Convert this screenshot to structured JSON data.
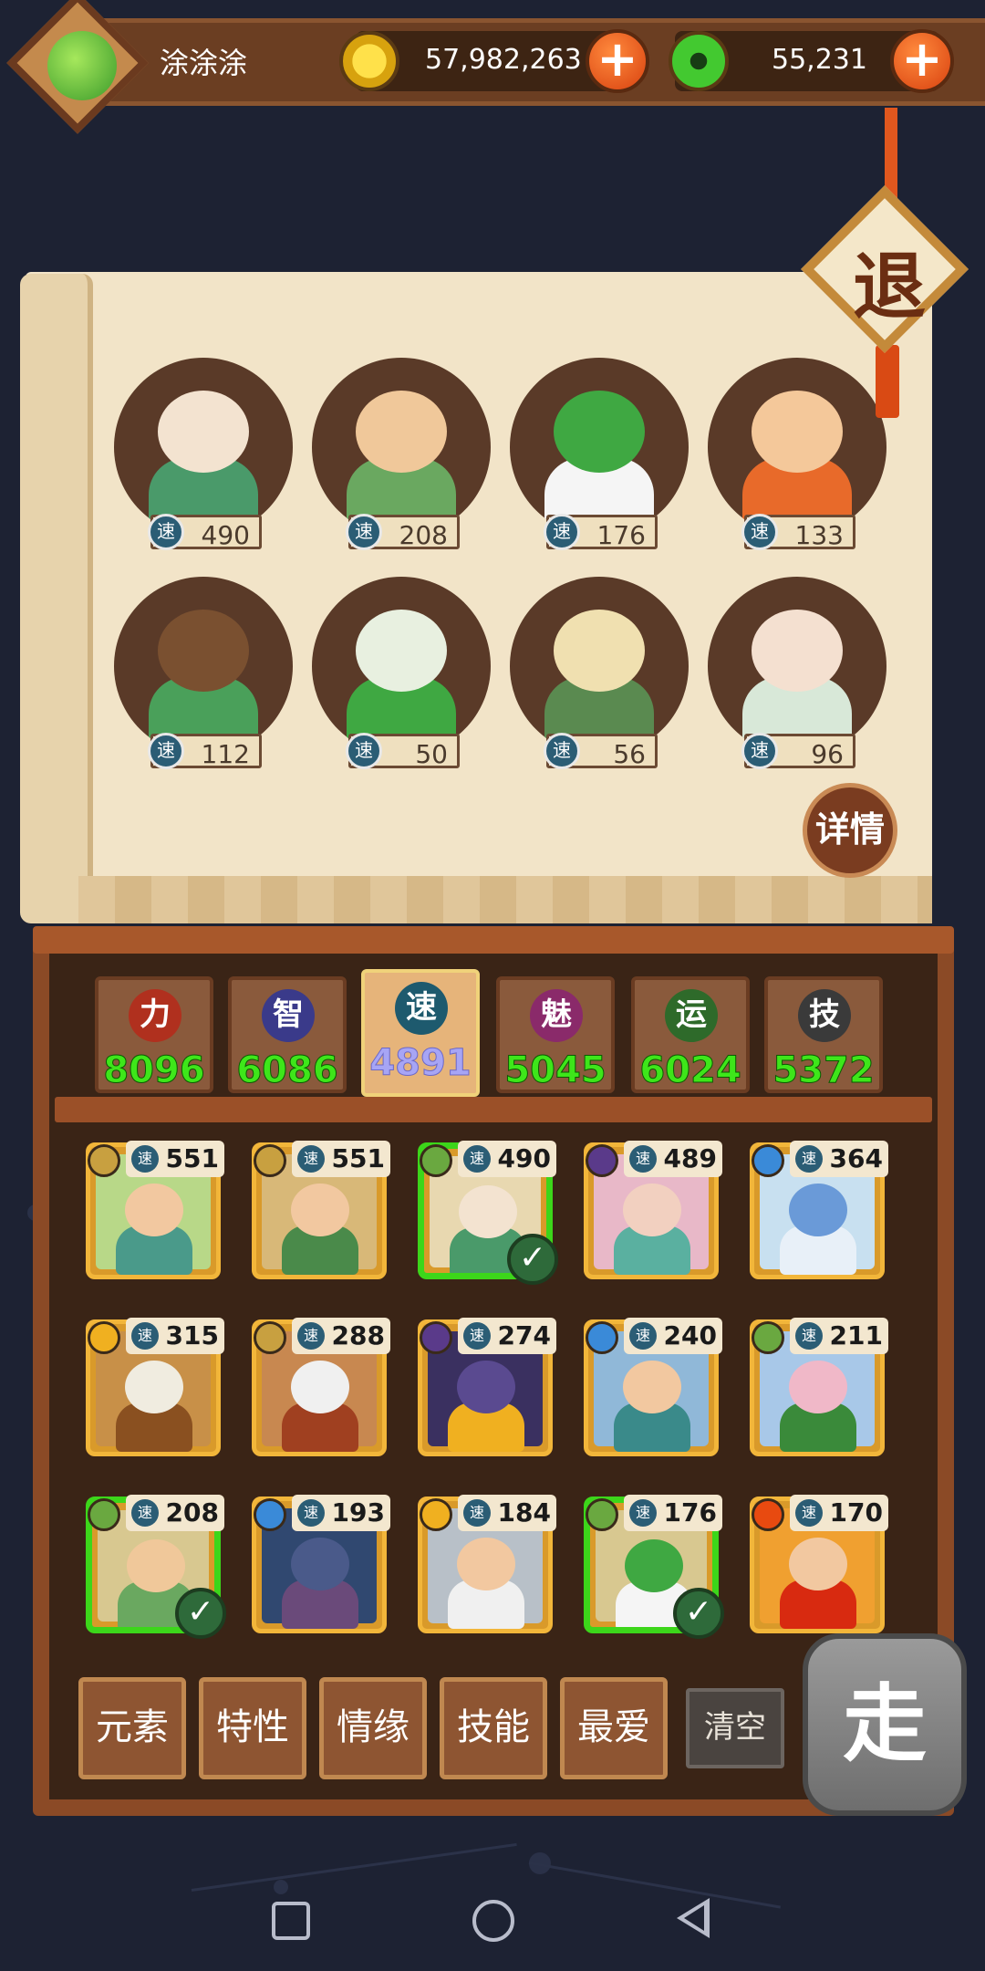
{
  "player": {
    "name": "涂涂涂",
    "gold": "57,982,263",
    "jade": "55,231",
    "plus_symbol": "+"
  },
  "exit_label": "退",
  "detail_label": "详情",
  "speed_char": "速",
  "team": [
    {
      "speed": "490",
      "color": "#f3e3d0",
      "body": "#4a9a6a"
    },
    {
      "speed": "208",
      "color": "#f0c89a",
      "body": "#6aa860"
    },
    {
      "speed": "176",
      "color": "#3fa842",
      "body": "#f5f5f5"
    },
    {
      "speed": "133",
      "color": "#f4c89a",
      "body": "#e86a2a"
    },
    {
      "speed": "112",
      "color": "#7a5030",
      "body": "#4aa05a"
    },
    {
      "speed": "50",
      "color": "#e8f0e0",
      "body": "#3fa842"
    },
    {
      "speed": "56",
      "color": "#f0e0b0",
      "body": "#5a8a50"
    },
    {
      "speed": "96",
      "color": "#f4e0d0",
      "body": "#d8e8d8"
    }
  ],
  "stats": [
    {
      "char": "力",
      "value": "8096",
      "circle": "#b0301e"
    },
    {
      "char": "智",
      "value": "6086",
      "circle": "#3a3a8a"
    },
    {
      "char": "速",
      "value": "4891",
      "circle": "#1e5a6e"
    },
    {
      "char": "魅",
      "value": "5045",
      "circle": "#8a2a6a"
    },
    {
      "char": "运",
      "value": "6024",
      "circle": "#2e6a2a"
    },
    {
      "char": "技",
      "value": "5372",
      "circle": "#3a3a3a"
    }
  ],
  "roster": [
    {
      "speed": "551",
      "element": "#c8a040",
      "selected": false,
      "bg": "#b8d888",
      "skin": "#f2c8a0",
      "cloth": "#4a9a8a"
    },
    {
      "speed": "551",
      "element": "#c8a040",
      "selected": false,
      "bg": "#d8b878",
      "skin": "#f2c8a0",
      "cloth": "#4a8a4a"
    },
    {
      "speed": "490",
      "element": "#6aa840",
      "selected": true,
      "bg": "#e8d8b0",
      "skin": "#f3e3d0",
      "cloth": "#4a9a6a"
    },
    {
      "speed": "489",
      "element": "#5a3a8a",
      "selected": false,
      "bg": "#e8b8c8",
      "skin": "#f2d0c0",
      "cloth": "#5ab0a0"
    },
    {
      "speed": "364",
      "element": "#3a8ad8",
      "selected": false,
      "bg": "#c8e0f0",
      "skin": "#6a9ad8",
      "cloth": "#e8f0f8"
    },
    {
      "speed": "315",
      "element": "#f0b020",
      "selected": false,
      "bg": "#c89048",
      "skin": "#f0ece0",
      "cloth": "#8a5020"
    },
    {
      "speed": "288",
      "element": "#c8a040",
      "selected": false,
      "bg": "#c88850",
      "skin": "#f0f0f0",
      "cloth": "#a04020"
    },
    {
      "speed": "274",
      "element": "#5a3a8a",
      "selected": false,
      "bg": "#3a3060",
      "skin": "#5a4a90",
      "cloth": "#f0b020"
    },
    {
      "speed": "240",
      "element": "#3a8ad8",
      "selected": false,
      "bg": "#90b8d8",
      "skin": "#f2c8a0",
      "cloth": "#3a8a8a"
    },
    {
      "speed": "211",
      "element": "#6aa840",
      "selected": false,
      "bg": "#a8c8e8",
      "skin": "#f0b8c8",
      "cloth": "#3a8a3a"
    },
    {
      "speed": "208",
      "element": "#6aa840",
      "selected": true,
      "bg": "#d8c890",
      "skin": "#f0c89a",
      "cloth": "#6aa860"
    },
    {
      "speed": "193",
      "element": "#3a8ad8",
      "selected": false,
      "bg": "#304870",
      "skin": "#4a5a8a",
      "cloth": "#6a4a7a"
    },
    {
      "speed": "184",
      "element": "#f0b020",
      "selected": false,
      "bg": "#b8c0c8",
      "skin": "#f2c8a0",
      "cloth": "#f0f0f0"
    },
    {
      "speed": "176",
      "element": "#6aa840",
      "selected": true,
      "bg": "#d8c890",
      "skin": "#3fa842",
      "cloth": "#f5f5f5"
    },
    {
      "speed": "170",
      "element": "#e84a10",
      "selected": false,
      "bg": "#f0a030",
      "skin": "#f2c8a0",
      "cloth": "#d82a10"
    }
  ],
  "filters": [
    "元素",
    "特性",
    "情缘",
    "技能",
    "最爱"
  ],
  "clear_label": "清空",
  "go_label": "走",
  "checkmark": "✓"
}
